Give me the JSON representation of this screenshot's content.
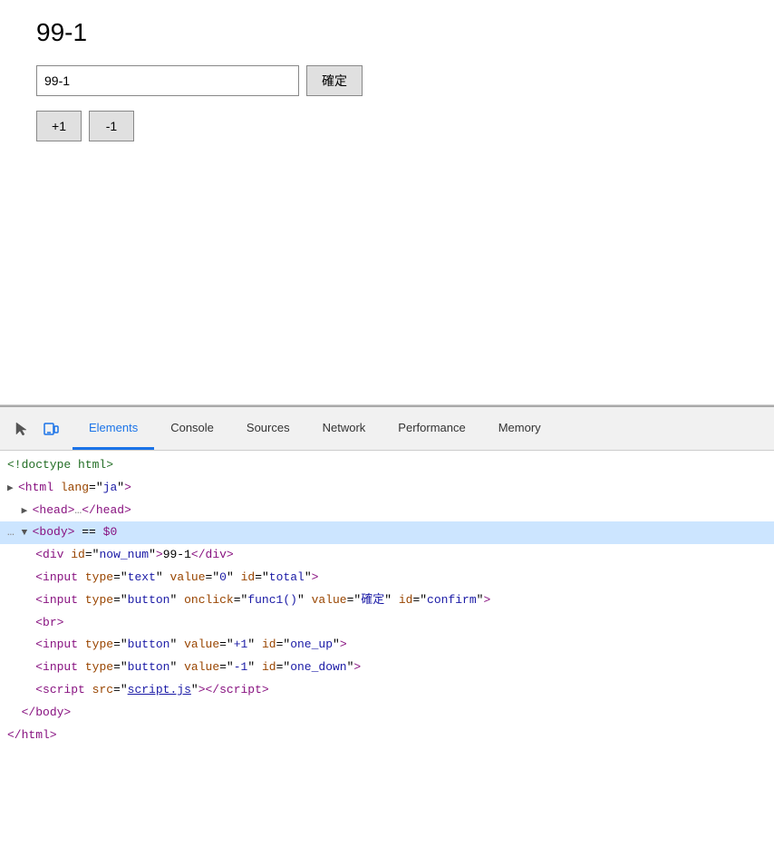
{
  "page": {
    "title": "99-1",
    "input_value": "99-1",
    "confirm_label": "確定",
    "increment_label": "+1",
    "decrement_label": "-1"
  },
  "devtools": {
    "icons": [
      {
        "name": "cursor-icon",
        "symbol": "↖",
        "active": false
      },
      {
        "name": "device-icon",
        "symbol": "⬜",
        "active": true
      }
    ],
    "tabs": [
      {
        "id": "elements",
        "label": "Elements",
        "active": true
      },
      {
        "id": "console",
        "label": "Console",
        "active": false
      },
      {
        "id": "sources",
        "label": "Sources",
        "active": false
      },
      {
        "id": "network",
        "label": "Network",
        "active": false
      },
      {
        "id": "performance",
        "label": "Performance",
        "active": false
      },
      {
        "id": "memory",
        "label": "Memory",
        "active": false
      }
    ],
    "elements": {
      "lines": [
        {
          "id": "line1",
          "content": "doctype",
          "selected": false
        },
        {
          "id": "line2",
          "content": "html_open",
          "selected": false
        },
        {
          "id": "line3",
          "content": "head_collapsed",
          "selected": false
        },
        {
          "id": "line4",
          "content": "body_open",
          "selected": true
        },
        {
          "id": "line5",
          "content": "div_now_num",
          "selected": false
        },
        {
          "id": "line6",
          "content": "input_text",
          "selected": false
        },
        {
          "id": "line7",
          "content": "input_button_confirm",
          "selected": false
        },
        {
          "id": "line8",
          "content": "br",
          "selected": false
        },
        {
          "id": "line9",
          "content": "input_one_up",
          "selected": false
        },
        {
          "id": "line10",
          "content": "input_one_down",
          "selected": false
        },
        {
          "id": "line11",
          "content": "script_src",
          "selected": false
        },
        {
          "id": "line12",
          "content": "body_close",
          "selected": false
        },
        {
          "id": "line13",
          "content": "html_close",
          "selected": false
        }
      ]
    }
  }
}
